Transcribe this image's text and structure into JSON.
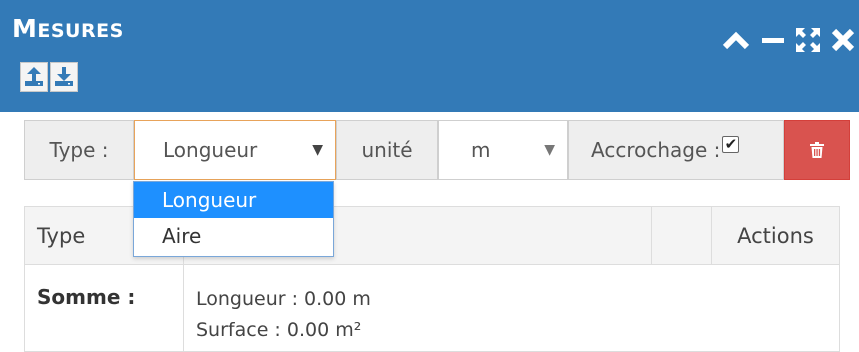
{
  "panel": {
    "title_first": "M",
    "title_rest": "ESURES",
    "upload_icon": "upload-icon",
    "download_icon": "download-icon",
    "window_controls": [
      "chevron-up-icon",
      "minimize-icon",
      "expand-icon",
      "close-icon"
    ]
  },
  "toolbar": {
    "type_label": "Type :",
    "type_value": "Longueur",
    "unit_label": "unité",
    "unit_value": "m",
    "snap_label": "Accrochage :",
    "snap_checked": true,
    "check_mark": "✔",
    "delete_icon": "trash-icon",
    "delete_color": "#d9534f"
  },
  "dropdown": {
    "options": [
      "Longueur",
      "Aire"
    ],
    "selected": "Longueur",
    "highlight_color": "#1e90ff"
  },
  "table": {
    "headers": {
      "type": "Type",
      "actions": "Actions"
    },
    "row": {
      "label": "Somme :",
      "length": "Longueur : 0.00 m",
      "surface": "Surface : 0.00 m²"
    }
  },
  "colors": {
    "header": "#337ab7",
    "accent_border": "#e8a35a"
  }
}
